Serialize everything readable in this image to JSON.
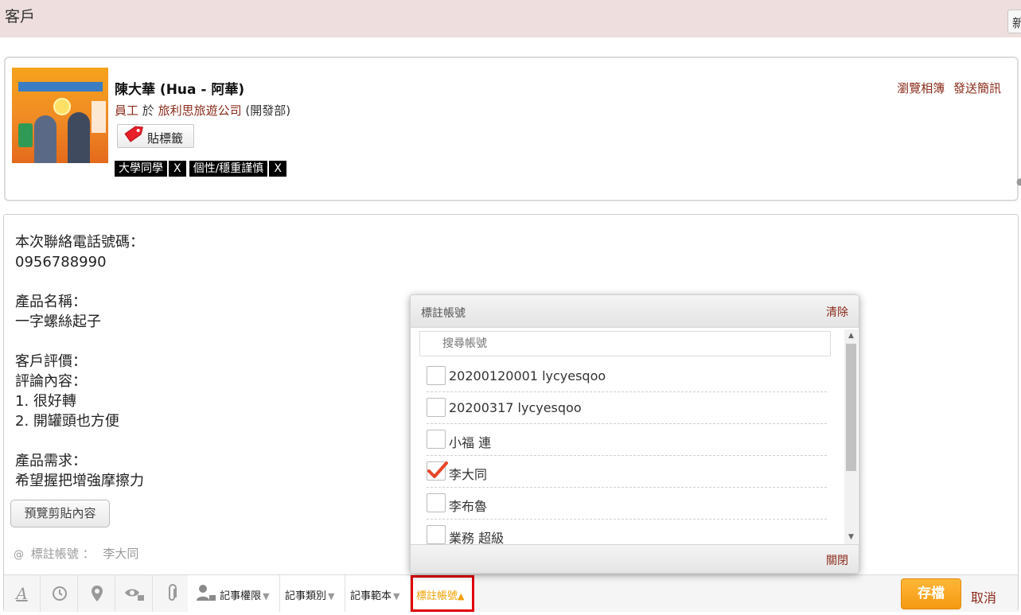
{
  "header": {
    "title": "客戶",
    "new_button_label": "新"
  },
  "contact": {
    "name": "陳大華 (Hua - 阿華)",
    "role": "員工",
    "at_word": "於",
    "company": "旅利思旅遊公司",
    "department": "(開發部)",
    "tag_button_label": "貼標籤",
    "tags": [
      {
        "label": "大學同學",
        "remove": "X"
      },
      {
        "label": "個性/穩重謹慎",
        "remove": "X"
      }
    ],
    "actions": {
      "browse_album": "瀏覽相簿",
      "send_sms": "發送簡訊"
    }
  },
  "note": {
    "lines": [
      "本次聯絡電話號碼：",
      "0956788990",
      "",
      "產品名稱：",
      "一字螺絲起子",
      "",
      "客戶評價：",
      "評論內容：",
      "1. 很好轉",
      "2. 開罐頭也方便",
      "",
      "產品需求：",
      "希望握把增強摩擦力"
    ],
    "preview_button_label": "預覽剪貼內容",
    "mention_at": "@",
    "mention_label": "標註帳號",
    "mention_sep": "：",
    "mention_value": "李大同"
  },
  "toolbar": {
    "icons": [
      "text-format-icon",
      "clock-icon",
      "location-pin-icon",
      "eye-lock-icon",
      "paperclip-icon",
      "user-lock-icon"
    ],
    "permission_label": "記事權限",
    "category_label": "記事類別",
    "template_label": "記事範本",
    "mention_label": "標註帳號",
    "save_label": "存檔",
    "cancel_label": "取消",
    "colors": {
      "save": "#f49a13",
      "mention_border": "#e00000"
    }
  },
  "popup": {
    "title": "標註帳號",
    "clear_label": "清除",
    "search_placeholder": "搜尋帳號",
    "items": [
      {
        "label": "20200120001 lycyesqoo",
        "checked": false
      },
      {
        "label": "20200317 lycyesqoo",
        "checked": false
      },
      {
        "label": "小福 連",
        "checked": false
      },
      {
        "label": "李大同",
        "checked": true
      },
      {
        "label": "李布魯",
        "checked": false
      },
      {
        "label": "業務 超級",
        "checked": false
      }
    ],
    "close_label": "關閉"
  }
}
